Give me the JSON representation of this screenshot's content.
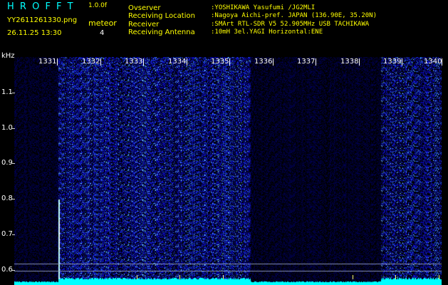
{
  "header": {
    "logo": "H R O F F T",
    "version": "1.0.0f",
    "filename": "YY2611261330.png",
    "datetime": "26.11.25 13:30",
    "meteor_label": "meteor",
    "meteor_count": "4",
    "info": [
      {
        "key": "Ovserver",
        "value": ":YOSHIKAWA Yasufumi /JG2MLI"
      },
      {
        "key": "Receiving Location",
        "value": ":Nagoya Aichi-pref. JAPAN (136.90E, 35.20N)"
      },
      {
        "key": "Receiver",
        "value": ":SMArt RTL-SDR V5 52.905MHz USB TACHIKAWA"
      },
      {
        "key": "Receiving Antenna",
        "value": ":10mH 3el.YAGI Horizontal:ENE"
      }
    ]
  },
  "axis": {
    "y_unit": "kHz",
    "y_labels": [
      "1.1",
      "1.0",
      "0.9",
      "0.8",
      "0.7",
      "0.6"
    ],
    "x_labels": [
      "1331",
      "1332",
      "1333",
      "1334",
      "1335",
      "1336",
      "1337",
      "1338",
      "1339",
      "1340"
    ]
  },
  "colors": {
    "header_cyan": "#00ffff",
    "header_yellow": "#ffff00",
    "noise_blue": "#0b0c9a",
    "baseline_cyan": "#00ffff"
  }
}
